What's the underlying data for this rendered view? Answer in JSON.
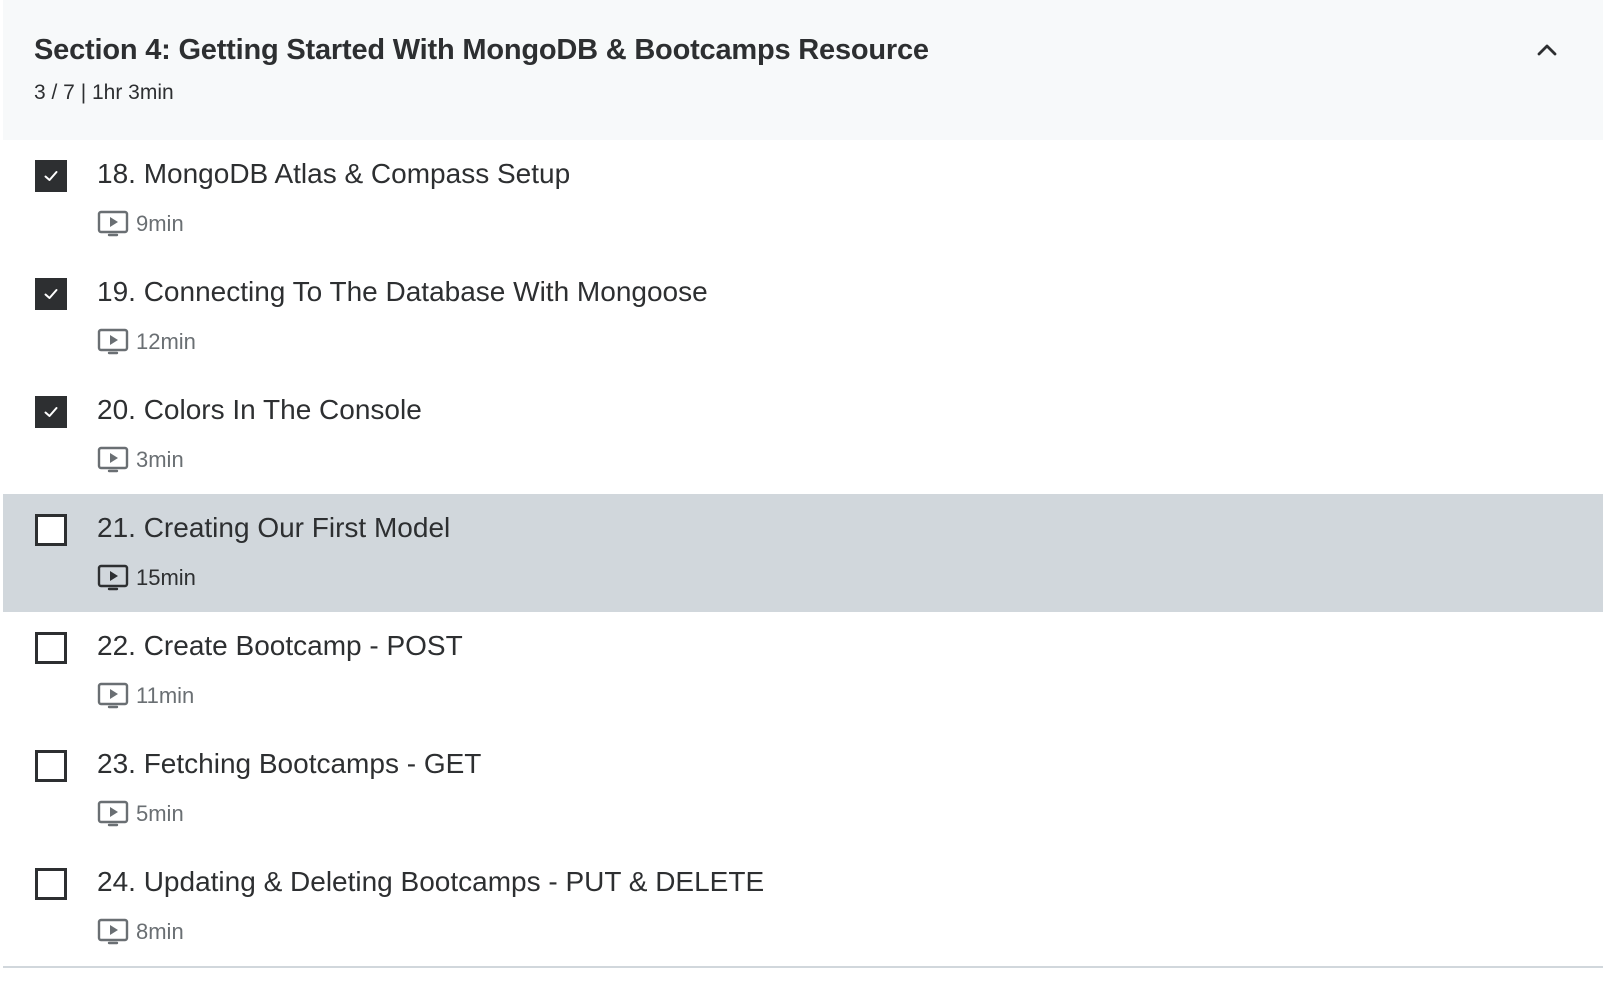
{
  "section": {
    "title": "Section 4: Getting Started With MongoDB & Bootcamps Resource",
    "meta": "3 / 7 | 1hr 3min",
    "collapse_icon": "chevron-up-icon"
  },
  "lessons": [
    {
      "title": "18. MongoDB Atlas & Compass Setup",
      "duration": "9min",
      "completed": true,
      "active": false,
      "icon": "video-icon"
    },
    {
      "title": "19. Connecting To The Database With Mongoose",
      "duration": "12min",
      "completed": true,
      "active": false,
      "icon": "video-icon"
    },
    {
      "title": "20. Colors In The Console",
      "duration": "3min",
      "completed": true,
      "active": false,
      "icon": "video-icon"
    },
    {
      "title": "21. Creating Our First Model",
      "duration": "15min",
      "completed": false,
      "active": true,
      "icon": "video-icon"
    },
    {
      "title": "22. Create Bootcamp - POST",
      "duration": "11min",
      "completed": false,
      "active": false,
      "icon": "video-icon"
    },
    {
      "title": "23. Fetching Bootcamps - GET",
      "duration": "5min",
      "completed": false,
      "active": false,
      "icon": "video-icon"
    },
    {
      "title": "24. Updating & Deleting Bootcamps - PUT & DELETE",
      "duration": "8min",
      "completed": false,
      "active": false,
      "icon": "video-icon"
    }
  ],
  "colors": {
    "text": "#2d2f31",
    "header_bg": "#f7f9fa",
    "active_bg": "#d1d7dc",
    "muted": "#6a6f73"
  }
}
